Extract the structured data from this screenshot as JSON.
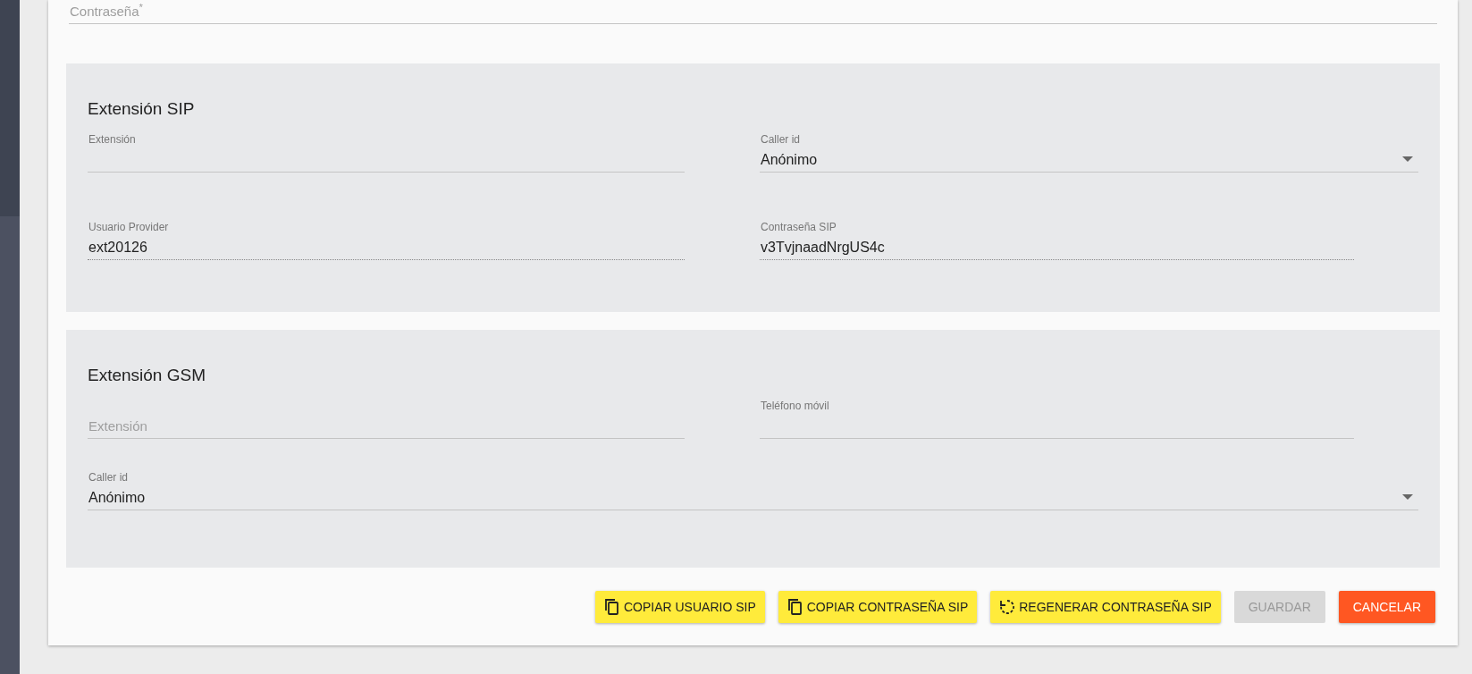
{
  "top_field": {
    "label": "Contraseña$^{*}$",
    "floated": false,
    "readonly": false
  },
  "sections": [
    {
      "title": "Extensión SIP",
      "rows": [
        [
          {
            "kind": "text",
            "label": "Extensión",
            "floated": true,
            "readonly": false
          },
          {
            "kind": "select",
            "label": "Caller id",
            "floated": true,
            "value": "Anónimo",
            "readonly": false
          }
        ],
        [
          {
            "kind": "text",
            "label": "Usuario Provider",
            "floated": true,
            "value": "ext20126",
            "readonly": true
          },
          {
            "kind": "text",
            "label": "Contraseña SIP",
            "floated": true,
            "value": "v3TvjnaadNrgUS4c",
            "readonly": true
          }
        ]
      ]
    },
    {
      "title": "Extensión GSM",
      "rows": [
        [
          {
            "kind": "text",
            "label": "Extensión",
            "floated": false,
            "readonly": false
          },
          {
            "kind": "text",
            "label": "Teléfono móvil",
            "floated": true,
            "readonly": false
          }
        ],
        [
          {
            "kind": "select",
            "label": "Caller id",
            "floated": true,
            "value": "Anónimo",
            "readonly": false
          }
        ]
      ]
    }
  ],
  "buttons": [
    {
      "label": "COPIAR USUARIO SIP",
      "kind": "copy",
      "disabled": false
    },
    {
      "label": "COPIAR CONTRASEÑA SIP",
      "kind": "copy",
      "disabled": false
    },
    {
      "label": "REGENERAR CONTRASEÑA SIP",
      "kind": "regenerate",
      "disabled": false
    },
    {
      "label": "GUARDAR",
      "kind": "save",
      "disabled": true
    },
    {
      "label": "CANCELAR",
      "kind": "cancel",
      "disabled": false
    }
  ]
}
